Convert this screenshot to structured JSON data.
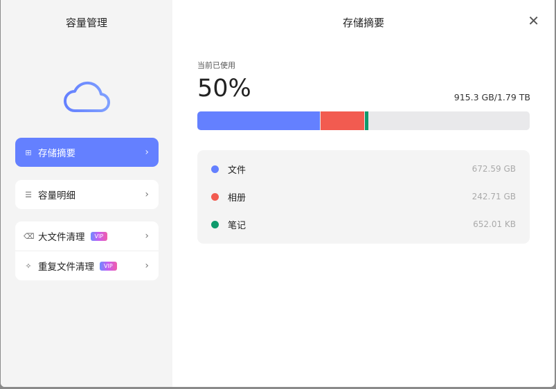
{
  "sidebar": {
    "title": "容量管理",
    "items": [
      {
        "label": "存储摘要",
        "icon": "grid-icon"
      },
      {
        "label": "容量明细",
        "icon": "list-icon"
      },
      {
        "label": "大文件清理",
        "icon": "broom-icon",
        "badge": "VIP"
      },
      {
        "label": "重复文件清理",
        "icon": "sparkle-icon",
        "badge": "VIP"
      }
    ]
  },
  "main": {
    "title": "存储摘要",
    "used_label": "当前已使用",
    "percent": "50%",
    "usage": "915.3 GB/1.79 TB",
    "segments": [
      {
        "name": "文件",
        "fraction": 0.369,
        "color": "#6480ff"
      },
      {
        "name": "相册",
        "fraction": 0.131,
        "color": "#f25b50"
      },
      {
        "name": "笔记",
        "fraction": 0.011,
        "color": "#0e9a6c"
      }
    ],
    "legend": [
      {
        "label": "文件",
        "size": "672.59 GB",
        "color": "#6480ff"
      },
      {
        "label": "相册",
        "size": "242.71 GB",
        "color": "#f25b50"
      },
      {
        "label": "笔记",
        "size": "652.01 KB",
        "color": "#0e9a6c"
      }
    ]
  }
}
